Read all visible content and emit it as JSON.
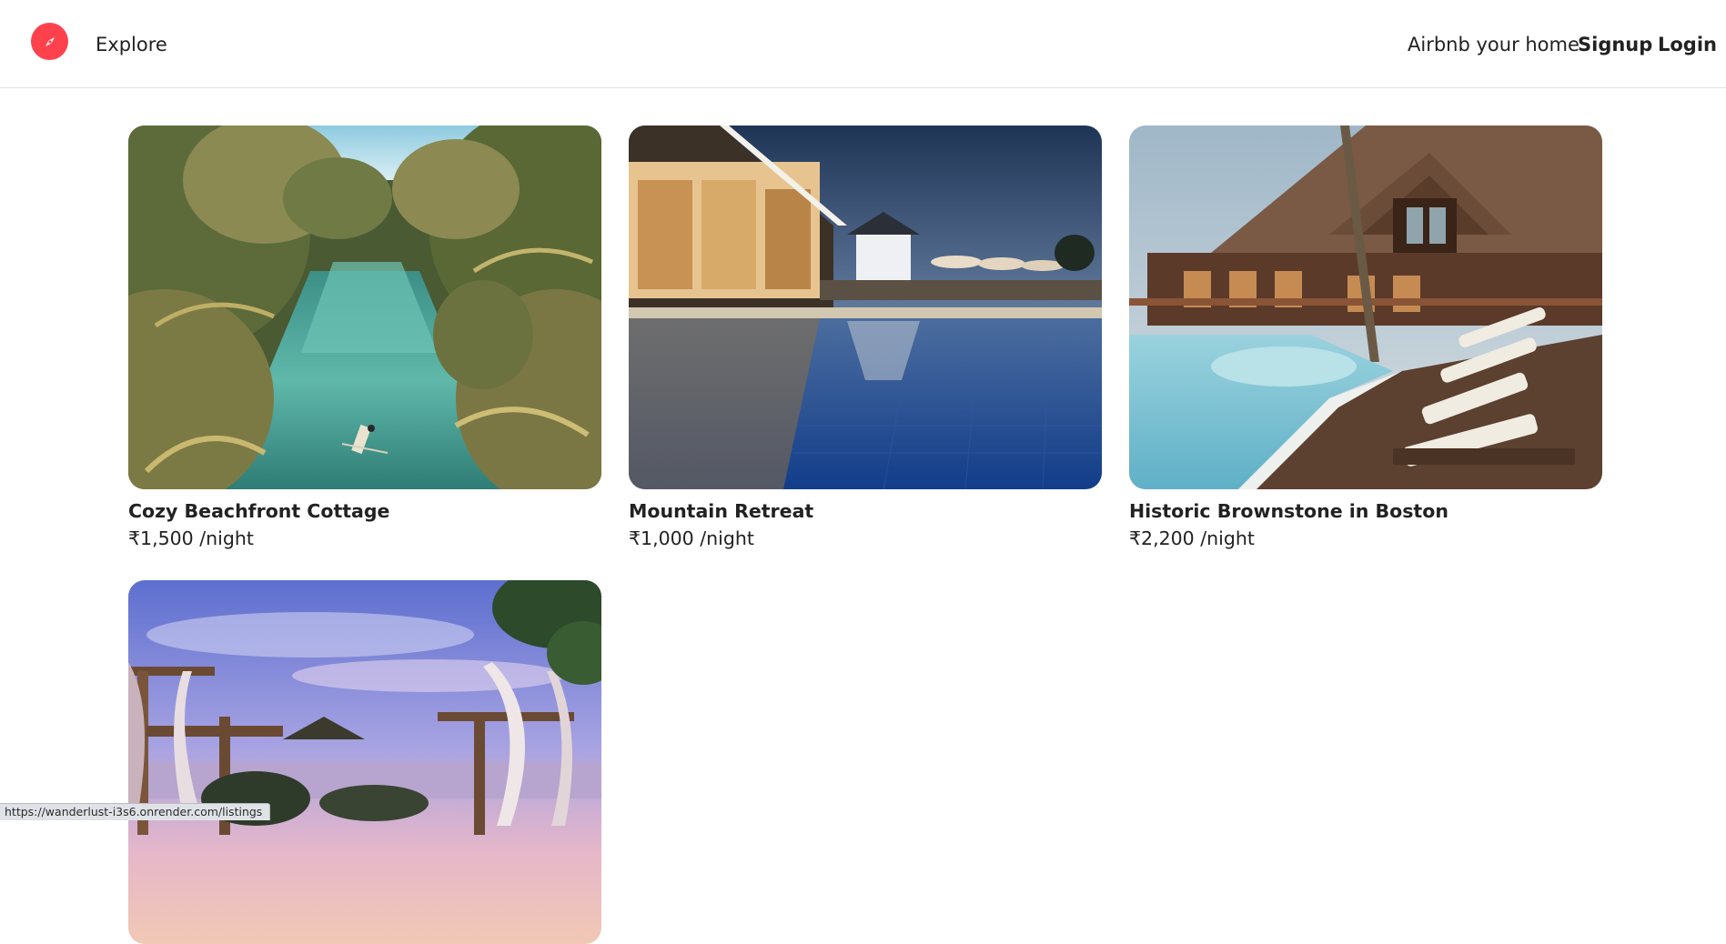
{
  "navbar": {
    "logo_icon": "compass-icon",
    "brand_color": "#fe424d",
    "explore_label": "Explore",
    "host_label": "Airbnb your home",
    "signup_label": "Signup",
    "login_label": "Login"
  },
  "listings": [
    {
      "title": "Cozy Beachfront Cottage",
      "price": "₹1,500 /night",
      "image": "tropical-lagoon-palms-photo"
    },
    {
      "title": "Mountain Retreat",
      "price": "₹1,000 /night",
      "image": "resort-pool-dusk-photo"
    },
    {
      "title": "Historic Brownstone in Boston",
      "price": "₹2,200 /night",
      "image": "lodge-pool-deck-photo"
    },
    {
      "title": "",
      "price": "",
      "image": "beach-cabanas-sunset-photo"
    }
  ],
  "status_bar": {
    "url": "https://wanderlust-i3s6.onrender.com/listings"
  }
}
